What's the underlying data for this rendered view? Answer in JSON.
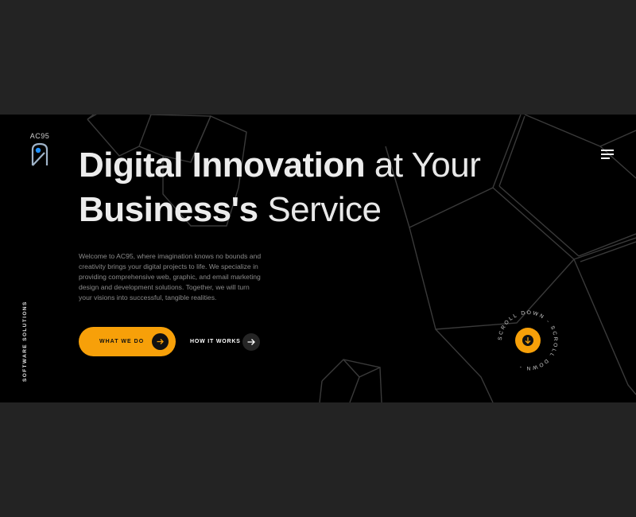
{
  "brand": {
    "logo_text": "AC95",
    "accent": "#f7a009",
    "accent_dot": "#1e90ff"
  },
  "nav": {
    "menu_icon": "hamburger-menu-icon"
  },
  "hero": {
    "headline_line1_strong": "Digital Innovation",
    "headline_line1_light": "at Your",
    "headline_line2_strong": "Business's",
    "headline_line2_light": "Service",
    "intro": "Welcome to AC95, where imagination knows no bounds and creativity brings your digital projects to life. We specialize in providing comprehensive web, graphic, and email marketing design and development solutions. Together, we will turn your visions into successful, tangible realities.",
    "primary_cta": "WHAT WE DO",
    "secondary_cta": "HOW IT WORKS",
    "side_label": "SOFTWARE SOLUTIONS"
  },
  "scroll": {
    "ring_text": "SCROLL DOWN - SCROLL DOWN - ",
    "icon": "arrow-down-icon"
  }
}
